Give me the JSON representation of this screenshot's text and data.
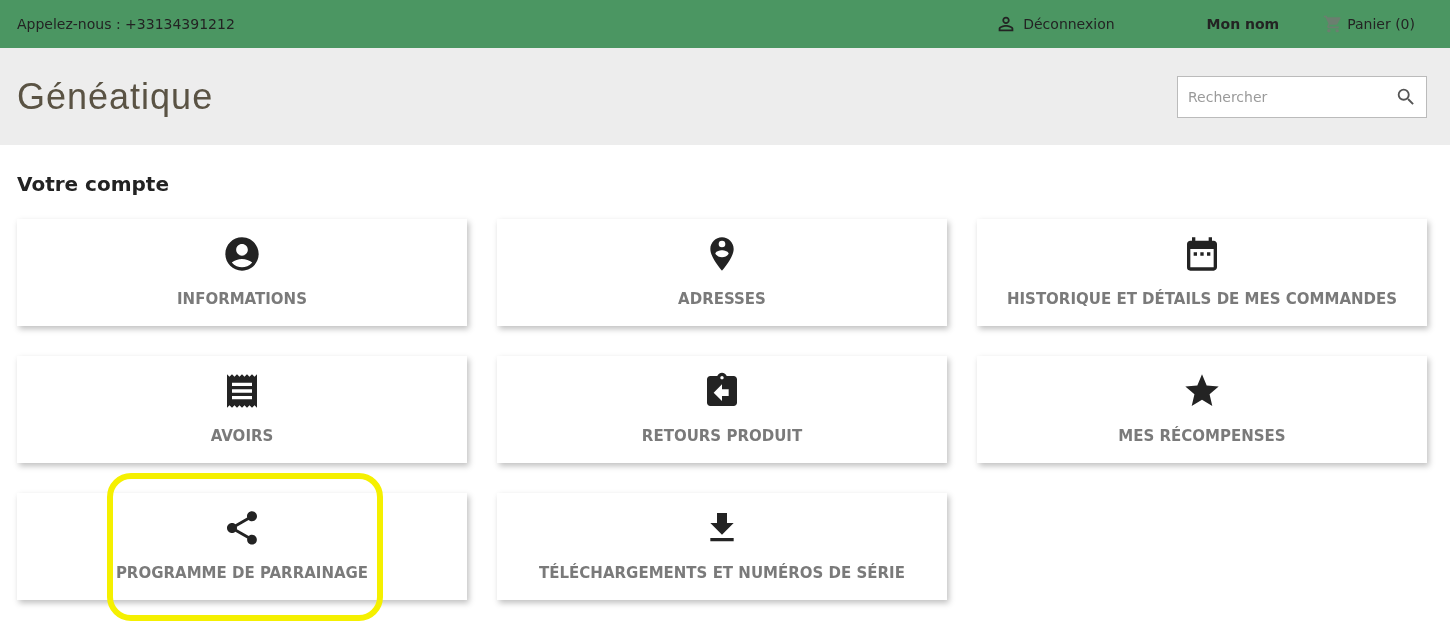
{
  "top_bar": {
    "phone": "Appelez-nous : +33134391212",
    "logout": "Déconnexion",
    "user_name": "Mon nom",
    "cart": "Panier (0)"
  },
  "header": {
    "logo": "Généatique",
    "search": {
      "placeholder": "Rechercher"
    }
  },
  "page_title": "Votre compte",
  "tiles": [
    {
      "kind": "user",
      "label": "INFORMATIONS",
      "highlighted": false
    },
    {
      "kind": "pin",
      "label": "ADRESSES",
      "highlighted": false
    },
    {
      "kind": "calendar",
      "label": "HISTORIQUE ET DÉTAILS DE MES COMMANDES",
      "highlighted": false
    },
    {
      "kind": "receipt",
      "label": "AVOIRS",
      "highlighted": false
    },
    {
      "kind": "return",
      "label": "RETOURS PRODUIT",
      "highlighted": false
    },
    {
      "kind": "star",
      "label": "MES RÉCOMPENSES",
      "highlighted": false
    },
    {
      "kind": "share",
      "label": "PROGRAMME DE PARRAINAGE",
      "highlighted": true
    },
    {
      "kind": "download",
      "label": "TÉLÉCHARGEMENTS ET NUMÉROS DE SÉRIE",
      "highlighted": false
    }
  ]
}
